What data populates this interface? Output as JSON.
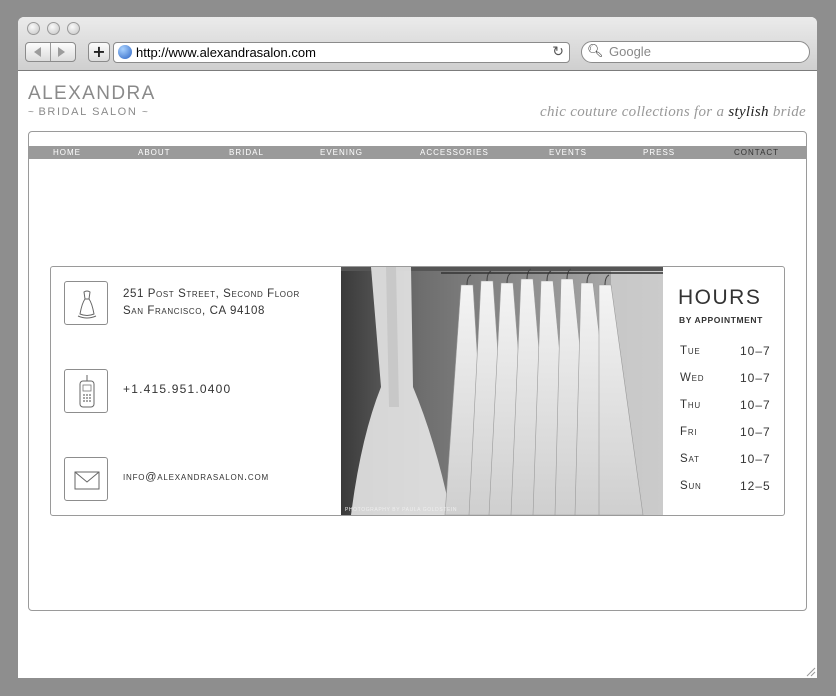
{
  "browser": {
    "url": "http://www.alexandrasalon.com",
    "search_placeholder": "Google"
  },
  "site": {
    "logo_main": "ALEXANDRA",
    "logo_sub": "BRIDAL SALON",
    "tagline_start": "chic couture collections for a ",
    "tagline_emphasis": "stylish",
    "tagline_end": " bride"
  },
  "nav": {
    "items": [
      "HOME",
      "ABOUT",
      "BRIDAL",
      "EVENING",
      "ACCESSORIES",
      "EVENTS",
      "PRESS",
      "CONTACT"
    ],
    "active": "CONTACT"
  },
  "contact": {
    "address_line1": "251 Post Street, Second Floor",
    "address_line2": "San Francisco, CA 94108",
    "phone": "+1.415.951.0400",
    "email": "info@alexandrasalon.com"
  },
  "photo": {
    "credit": "Photography by Paula Goldstein"
  },
  "hours": {
    "title": "HOURS",
    "subtitle": "BY APPOINTMENT",
    "rows": [
      {
        "day": "Tue",
        "time": "10–7"
      },
      {
        "day": "Wed",
        "time": "10–7"
      },
      {
        "day": "Thu",
        "time": "10–7"
      },
      {
        "day": "Fri",
        "time": "10–7"
      },
      {
        "day": "Sat",
        "time": "10–7"
      },
      {
        "day": "Sun",
        "time": "12–5"
      }
    ]
  }
}
